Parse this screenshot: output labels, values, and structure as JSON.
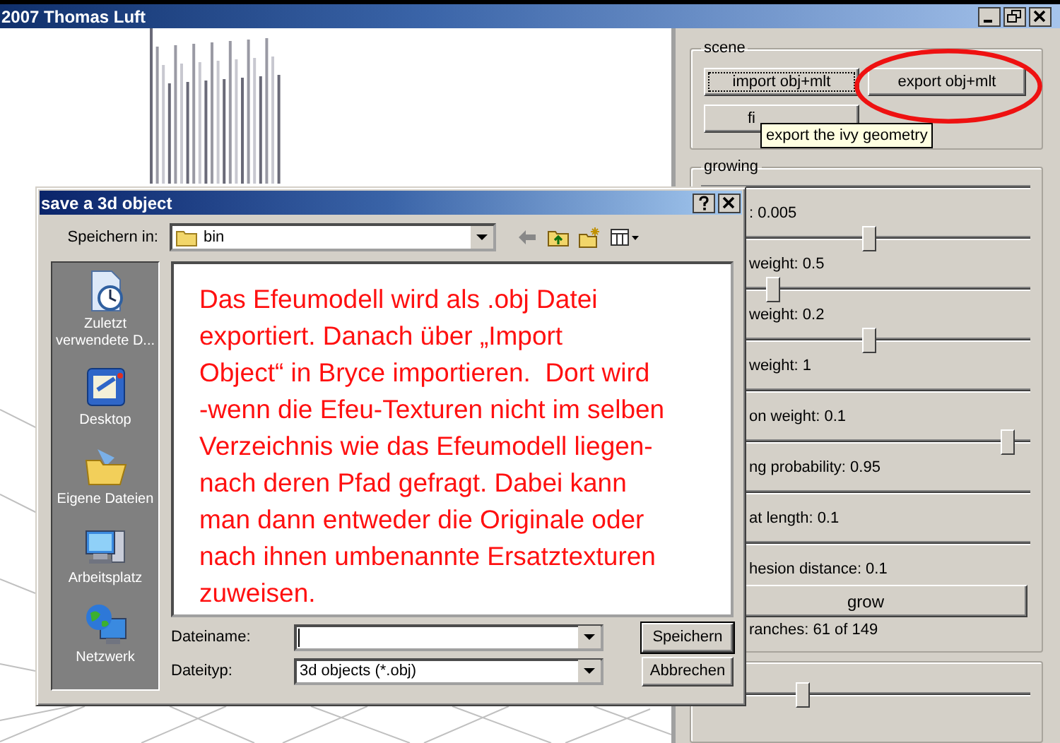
{
  "window": {
    "title": "2007 Thomas Luft"
  },
  "scene": {
    "title": "scene",
    "buttons": [
      {
        "label": "import obj+mlt",
        "focused": true
      },
      {
        "label": "export obj+mlt",
        "focused": false
      },
      {
        "label": "fi",
        "focused": false
      }
    ],
    "tooltip": "export the ivy geometry"
  },
  "growing": {
    "title": "growing",
    "rows": [
      {
        "kind": "slider"
      },
      {
        "kind": "slider",
        "label": ": 0.005",
        "level": 0.51
      },
      {
        "kind": "slider",
        "label": "weight: 0.5",
        "level": 0.22
      },
      {
        "kind": "slider",
        "label": "weight: 0.2",
        "level": 0.51
      },
      {
        "kind": "slider",
        "label": "weight: 1"
      },
      {
        "kind": "slider",
        "label": "on weight: 0.1",
        "level": 0.93
      },
      {
        "kind": "slider",
        "label": "ng probability: 0.95"
      },
      {
        "kind": "slider",
        "label": "at length: 0.1"
      },
      {
        "kind": "label",
        "label": "hesion distance: 0.1"
      }
    ],
    "grow_button": "grow",
    "status": "ranches: 61 of 149"
  },
  "bottom_group": {
    "level": 0.31
  },
  "dialog": {
    "title": "save a 3d object",
    "save_in_label": "Speichern in:",
    "save_in": "bin",
    "places": [
      {
        "kind": "recent",
        "label": "Zuletzt verwendete D..."
      },
      {
        "kind": "desktop",
        "label": "Desktop"
      },
      {
        "kind": "documents",
        "label": "Eigene Dateien"
      },
      {
        "kind": "computer",
        "label": "Arbeitsplatz"
      },
      {
        "kind": "network",
        "label": "Netzwerk"
      }
    ],
    "annotation": [
      "Das Efeumodell wird als .obj Datei",
      "exportiert. Danach über „Import",
      "Object“ in Bryce importieren.  Dort wird",
      "-wenn die Efeu-Texturen nicht im selben",
      "Verzeichnis wie das Efeumodell liegen-",
      "nach deren Pfad gefragt. Dabei kann",
      "man dann entweder die Originale oder",
      "nach ihnen umbenannte Ersatztexturen",
      "zuweisen."
    ],
    "filename_label": "Dateiname:",
    "filetype_label": "Dateityp:",
    "filetype": "3d objects (*.obj)",
    "save_button": "Speichern",
    "cancel_button": "Abbrechen"
  }
}
